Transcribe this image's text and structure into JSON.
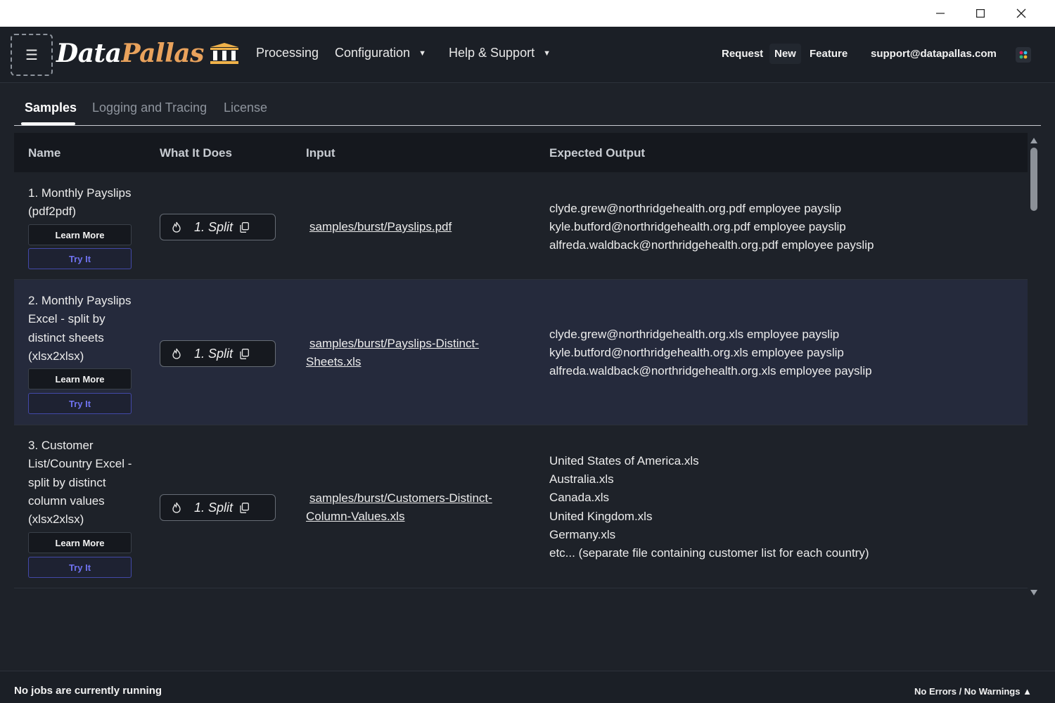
{
  "window": {
    "controls": {
      "minimize": "minimize-icon",
      "maximize": "maximize-icon",
      "close": "close-icon"
    }
  },
  "header": {
    "logo_part1": "Data",
    "logo_part2": "Pallas",
    "menu_icon": "☰",
    "nav": [
      {
        "label": "Processing"
      },
      {
        "label": "Configuration",
        "caret": "▼"
      },
      {
        "label": "Help & Support",
        "caret": "▼"
      }
    ],
    "request": "Request",
    "new": "New",
    "feature": "Feature",
    "support_email": "support@datapallas.com"
  },
  "tabs": [
    {
      "label": "Samples",
      "active": true
    },
    {
      "label": "Logging and Tracing"
    },
    {
      "label": "License"
    }
  ],
  "table": {
    "columns": [
      "Name",
      "What It Does",
      "Input",
      "Expected Output"
    ],
    "learn_more_label": "Learn More",
    "try_it_label": "Try It",
    "split_label": "1. Split",
    "rows": [
      {
        "name": "1. Monthly Payslips (pdf2pdf)",
        "input": "samples/burst/Payslips.pdf",
        "output": [
          "clyde.grew@northridgehealth.org.pdf employee payslip",
          "kyle.butford@northridgehealth.org.pdf employee payslip",
          "alfreda.waldback@northridgehealth.org.pdf employee payslip"
        ]
      },
      {
        "name": "2. Monthly Payslips Excel - split by distinct sheets (xlsx2xlsx)",
        "input": "samples/burst/Payslips-Distinct-Sheets.xls",
        "output": [
          "clyde.grew@northridgehealth.org.xls employee payslip",
          "kyle.butford@northridgehealth.org.xls employee payslip",
          "alfreda.waldback@northridgehealth.org.xls employee payslip"
        ]
      },
      {
        "name": "3. Customer List/Country Excel - split by distinct column values (xlsx2xlsx)",
        "input": "samples/burst/Customers-Distinct-Column-Values.xls",
        "output": [
          "United States of America.xls",
          "Australia.xls",
          "Canada.xls",
          "United Kingdom.xls",
          "Germany.xls",
          "etc... (separate file containing customer list for each country)"
        ]
      }
    ]
  },
  "status": {
    "left": "No jobs are currently running",
    "right": "No Errors / No Warnings ▲"
  },
  "colors": {
    "accent_try": "#6f72ef",
    "logo_orange": "#e9a25c",
    "highlight_row": "#252a3c"
  }
}
